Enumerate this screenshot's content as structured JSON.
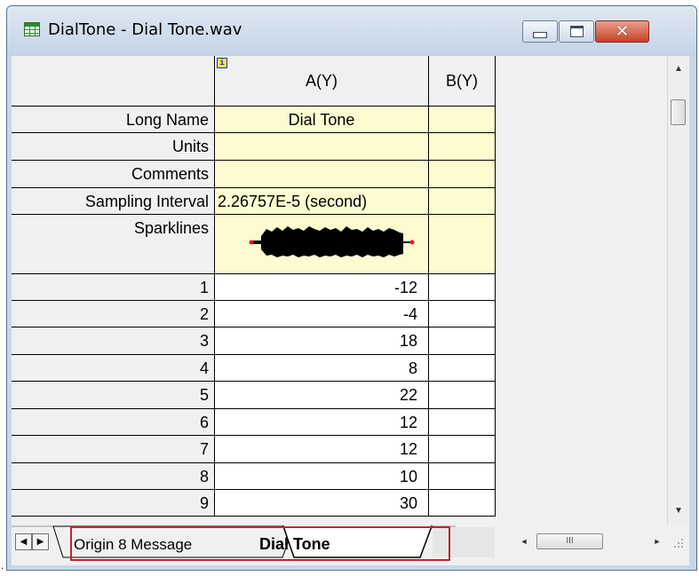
{
  "window": {
    "title": "DialTone - Dial Tone.wav",
    "controls": {
      "minimize": "minimize",
      "maximize": "maximize",
      "close": "✕"
    }
  },
  "columns": [
    {
      "name": "A(Y)",
      "has_info_icon": true
    },
    {
      "name": "B(Y)"
    }
  ],
  "info_icon": "i",
  "header_rows": [
    {
      "label": "Long Name",
      "a": "Dial Tone",
      "b": ""
    },
    {
      "label": "Units",
      "a": "",
      "b": ""
    },
    {
      "label": "Comments",
      "a": "",
      "b": ""
    },
    {
      "label": "Sampling Interval",
      "a": "2.26757E-5 (second)",
      "b": ""
    },
    {
      "label": "Sparklines",
      "a": "",
      "b": ""
    }
  ],
  "data_rows": [
    {
      "row": "1",
      "a": "-12",
      "b": ""
    },
    {
      "row": "2",
      "a": "-4",
      "b": ""
    },
    {
      "row": "3",
      "a": "18",
      "b": ""
    },
    {
      "row": "4",
      "a": "8",
      "b": ""
    },
    {
      "row": "5",
      "a": "22",
      "b": ""
    },
    {
      "row": "6",
      "a": "12",
      "b": ""
    },
    {
      "row": "7",
      "a": "12",
      "b": ""
    },
    {
      "row": "8",
      "a": "10",
      "b": ""
    },
    {
      "row": "9",
      "a": "30",
      "b": ""
    }
  ],
  "sheet_tabs": [
    {
      "label": "Origin 8 Message",
      "active": false
    },
    {
      "label": "Dial Tone",
      "active": true
    }
  ],
  "scrollbars": {
    "up_arrow": "▲",
    "down_arrow": "▼",
    "left_arrow": "◄",
    "right_arrow": "►",
    "thumb_grip": "III",
    "tab_nav_left": "◀",
    "tab_nav_right": "▶"
  },
  "colors": {
    "label_cell_yellow": "#fdfbd0",
    "highlight_border": "#c0262f",
    "sparkline": "#000000",
    "sparkline_endpoint": "#e02020",
    "close_button": "#c6402a"
  }
}
